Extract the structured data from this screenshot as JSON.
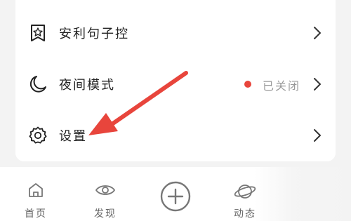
{
  "menu": {
    "items": [
      {
        "label": "安利句子控",
        "icon": "star-bookmark-icon"
      },
      {
        "label": "夜间模式",
        "icon": "moon-icon",
        "status": "已关闭",
        "status_color": "#e8453c"
      },
      {
        "label": "设置",
        "icon": "gear-icon"
      }
    ]
  },
  "tabbar": {
    "tabs": [
      {
        "label": "首页",
        "icon": "home-icon"
      },
      {
        "label": "发现",
        "icon": "eye-icon"
      },
      {
        "label": "",
        "icon": "add-circle-icon"
      },
      {
        "label": "动态",
        "icon": "planet-icon"
      }
    ]
  },
  "annotation": {
    "arrow_color": "#e8453c",
    "arrow_target": "settings"
  }
}
